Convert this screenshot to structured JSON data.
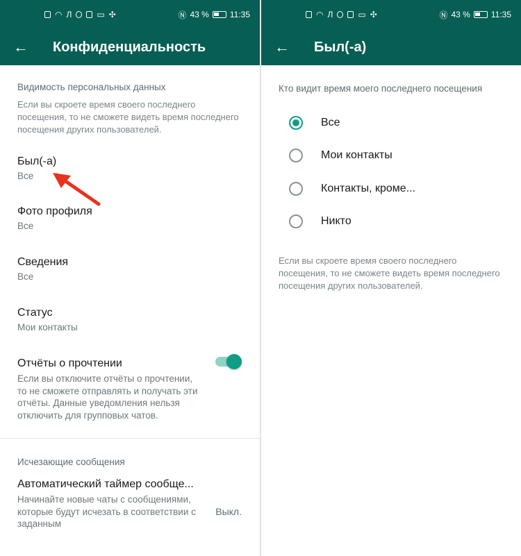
{
  "status_bar": {
    "battery": "43 %",
    "time": "11:35"
  },
  "left": {
    "title": "Конфиденциальность",
    "visibility_header": "Видимость персональных данных",
    "visibility_hint": "Если вы скроете время своего последнего посещения, то не сможете видеть время последнего посещения других пользователей.",
    "items": [
      {
        "title": "Был(-а)",
        "value": "Все"
      },
      {
        "title": "Фото профиля",
        "value": "Все"
      },
      {
        "title": "Сведения",
        "value": "Все"
      },
      {
        "title": "Статус",
        "value": "Мои контакты"
      }
    ],
    "read_receipts": {
      "title": "Отчёты о прочтении",
      "desc": "Если вы отключите отчёты о прочтении, то не сможете отправлять и получать эти отчёты. Данные уведомления нельзя отключить для групповых чатов.",
      "enabled": true
    },
    "disappearing_header": "Исчезающие сообщения",
    "timer": {
      "title": "Автоматический таймер сообще...",
      "desc": "Начинайте новые чаты с сообщениями, которые будут исчезать в соответствии с заданным",
      "value": "Выкл."
    }
  },
  "right": {
    "title": "Был(-а)",
    "question": "Кто видит время моего последнего посещения",
    "options": [
      {
        "label": "Все",
        "selected": true
      },
      {
        "label": "Мои контакты",
        "selected": false
      },
      {
        "label": "Контакты, кроме...",
        "selected": false
      },
      {
        "label": "Никто",
        "selected": false
      }
    ],
    "hint": "Если вы скроете время своего последнего посещения, то не сможете видеть время последнего посещения других пользователей."
  },
  "colors": {
    "app_bar": "#075e54",
    "accent": "#0f9e85",
    "annotation_arrow": "#e8321c"
  }
}
